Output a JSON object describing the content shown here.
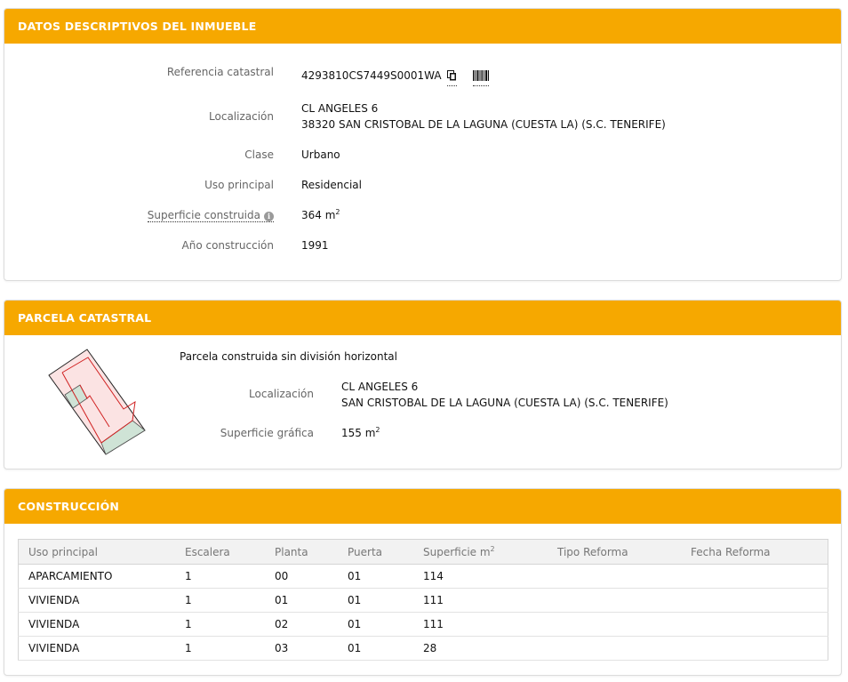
{
  "datos": {
    "header": "DATOS DESCRIPTIVOS DEL INMUEBLE",
    "ref_label": "Referencia catastral",
    "ref_value": "4293810CS7449S0001WA",
    "loc_label": "Localización",
    "loc_line1": "CL ANGELES 6",
    "loc_line2": "38320 SAN CRISTOBAL DE LA LAGUNA (CUESTA LA) (S.C. TENERIFE)",
    "clase_label": "Clase",
    "clase_value": "Urbano",
    "uso_label": "Uso principal",
    "uso_value": "Residencial",
    "sup_label": "Superficie construida",
    "sup_value": "364 m",
    "sup_unit_exp": "2",
    "anio_label": "Año construcción",
    "anio_value": "1991"
  },
  "parcela": {
    "header": "PARCELA CATASTRAL",
    "desc": "Parcela construida sin división horizontal",
    "loc_label": "Localización",
    "loc_line1": "CL ANGELES 6",
    "loc_line2": "SAN CRISTOBAL DE LA LAGUNA (CUESTA LA) (S.C. TENERIFE)",
    "sup_label": "Superficie gráfica",
    "sup_value": "155 m",
    "sup_unit_exp": "2"
  },
  "construccion": {
    "header": "CONSTRUCCIÓN",
    "columns": [
      "Uso principal",
      "Escalera",
      "Planta",
      "Puerta",
      "Superficie m",
      "Tipo Reforma",
      "Fecha Reforma"
    ],
    "sup_col_exp": "2",
    "rows": [
      [
        "APARCAMIENTO",
        "1",
        "00",
        "01",
        "114",
        "",
        ""
      ],
      [
        "VIVIENDA",
        "1",
        "01",
        "01",
        "111",
        "",
        ""
      ],
      [
        "VIVIENDA",
        "1",
        "02",
        "01",
        "111",
        "",
        ""
      ],
      [
        "VIVIENDA",
        "1",
        "03",
        "01",
        "28",
        "",
        ""
      ]
    ]
  },
  "colors": {
    "header_bg": "#f6a800",
    "header_text": "#ffffff",
    "parcel_fill": "#fbe3e3",
    "parcel_patio_fill": "#cfe3d6",
    "parcel_line": "#d02020"
  }
}
